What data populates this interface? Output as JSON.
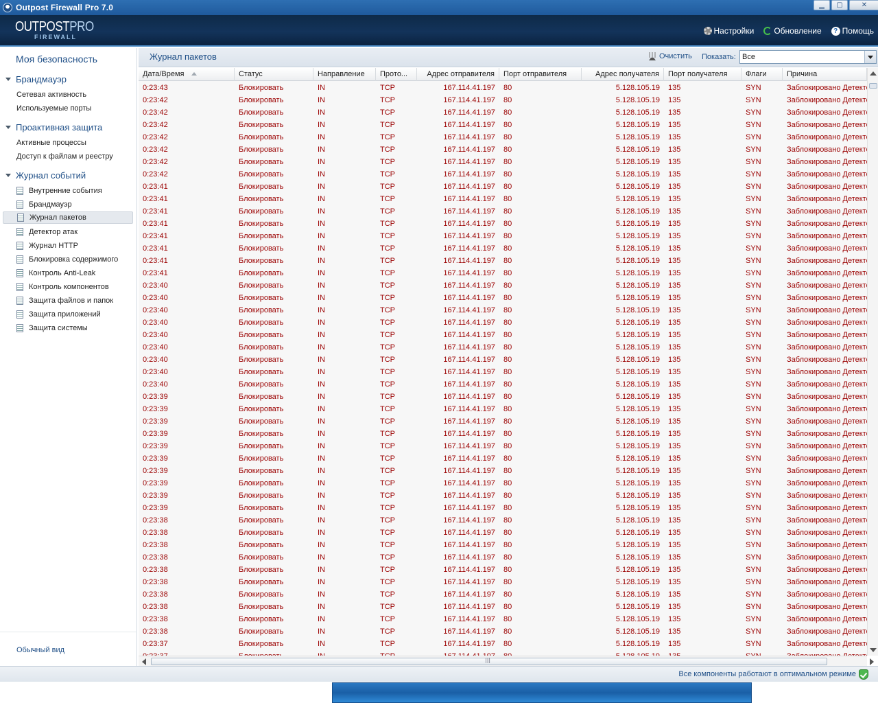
{
  "window": {
    "title": "Outpost Firewall Pro 7.0"
  },
  "logo": {
    "line1_a": "OUTPOST",
    "line1_b": "PRO",
    "line2": "FIREWALL"
  },
  "header_menu": {
    "settings": "Настройки",
    "update": "Обновление",
    "help": "Помощь"
  },
  "sidebar": {
    "top": "Моя безопасность",
    "sections": [
      {
        "title": "Брандмауэр",
        "items": [
          "Сетевая активность",
          "Используемые порты"
        ]
      },
      {
        "title": "Проактивная защита",
        "items": [
          "Активные процессы",
          "Доступ к файлам и реестру"
        ]
      },
      {
        "title": "Журнал событий",
        "items": [
          "Внутренние события",
          "Брандмауэр",
          "Журнал пакетов",
          "Детектор атак",
          "Журнал HTTP",
          "Блокировка содержимого",
          "Контроль Anti-Leak",
          "Контроль компонентов",
          "Защита файлов и папок",
          "Защита приложений",
          "Защита системы"
        ]
      }
    ],
    "selected_log_item": "Журнал пакетов",
    "bottom_link": "Обычный вид"
  },
  "toolbar": {
    "title": "Журнал пакетов",
    "clear": "Очистить",
    "show_label": "Показать:",
    "show_value": "Все"
  },
  "table": {
    "columns": [
      "Дата/Время",
      "Статус",
      "Направление",
      "Прото...",
      "Адрес отправителя",
      "Порт отправителя",
      "Адрес получателя",
      "Порт получателя",
      "Флаги",
      "Причина"
    ],
    "times": [
      "0:23:43",
      "0:23:42",
      "0:23:42",
      "0:23:42",
      "0:23:42",
      "0:23:42",
      "0:23:42",
      "0:23:42",
      "0:23:41",
      "0:23:41",
      "0:23:41",
      "0:23:41",
      "0:23:41",
      "0:23:41",
      "0:23:41",
      "0:23:41",
      "0:23:40",
      "0:23:40",
      "0:23:40",
      "0:23:40",
      "0:23:40",
      "0:23:40",
      "0:23:40",
      "0:23:40",
      "0:23:40",
      "0:23:39",
      "0:23:39",
      "0:23:39",
      "0:23:39",
      "0:23:39",
      "0:23:39",
      "0:23:39",
      "0:23:39",
      "0:23:39",
      "0:23:39",
      "0:23:38",
      "0:23:38",
      "0:23:38",
      "0:23:38",
      "0:23:38",
      "0:23:38",
      "0:23:38",
      "0:23:38",
      "0:23:38",
      "0:23:38",
      "0:23:37",
      "0:23:37"
    ],
    "row_template": {
      "status": "Блокировать",
      "direction": "IN",
      "protocol": "TCP",
      "src_addr": "167.114.41.197",
      "src_port": "80",
      "dst_addr": "5.128.105.19",
      "dst_port": "135",
      "flags": "SYN",
      "reason": "Заблокировано Детектором атак"
    }
  },
  "statusbar": {
    "text": "Все компоненты работают в оптимальном режиме"
  },
  "colors": {
    "accent": "#1f4f87",
    "blocked_text": "#9b0000",
    "header_bg": "#13335a"
  }
}
